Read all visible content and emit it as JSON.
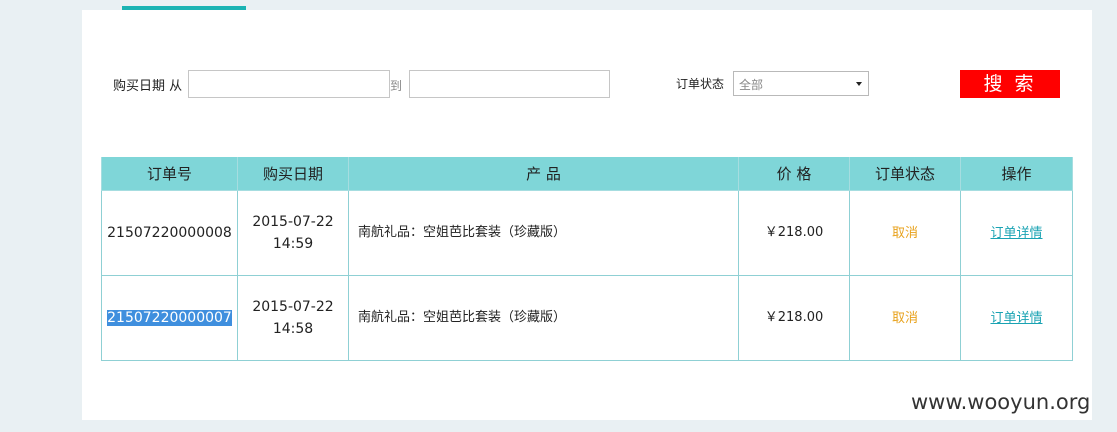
{
  "filters": {
    "date_label": "购买日期 从",
    "to_label": "到",
    "from_value": "",
    "to_value": "",
    "status_label": "订单状态",
    "status_selected": "全部",
    "search_label": "搜 索"
  },
  "table": {
    "headers": [
      "订单号",
      "购买日期",
      "产 品",
      "价 格",
      "订单状态",
      "操作"
    ],
    "rows": [
      {
        "order_no": "21507220000008",
        "date": "2015-07-22",
        "time": "14:59",
        "product": "南航礼品：空姐芭比套装（珍藏版）",
        "price": "￥218.00",
        "status": "取消",
        "action": "订单详情"
      },
      {
        "order_no": "21507220000007",
        "date": "2015-07-22",
        "time": "14:58",
        "product": "南航礼品：空姐芭比套装（珍藏版）",
        "price": "￥218.00",
        "status": "取消",
        "action": "订单详情"
      }
    ]
  },
  "watermark": "www.wooyun.org",
  "colors": {
    "header_bg": "#7fd6d8",
    "search_button": "#ff0000",
    "accent": "#1ab3b3",
    "status_cancel": "#e8a21c",
    "link": "#1aa3b3",
    "selection": "#3f8fde"
  }
}
